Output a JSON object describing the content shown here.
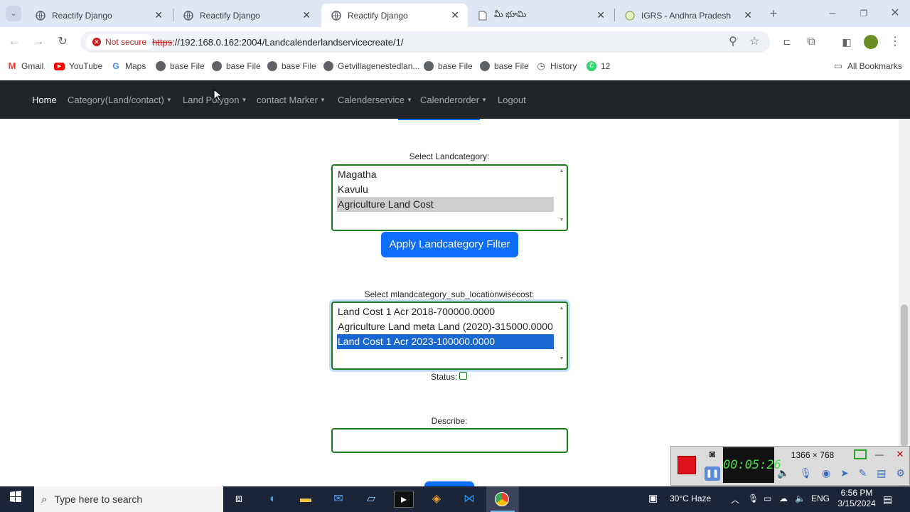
{
  "browser": {
    "tabs": [
      {
        "title": "Reactify Django",
        "active": false
      },
      {
        "title": "Reactify Django",
        "active": false
      },
      {
        "title": "Reactify Django",
        "active": true
      },
      {
        "title": "మీ భూమి",
        "active": false
      },
      {
        "title": "IGRS - Andhra Pradesh",
        "active": false
      }
    ],
    "security_label": "Not secure",
    "url_scheme": "https",
    "url_rest": "://192.168.0.162:2004/Landcalenderlandservicecreate/1/",
    "bookmarks": [
      "Gmail",
      "YouTube",
      "Maps",
      "base File",
      "base File",
      "base File",
      "Getvillagenestedlan...",
      "base File",
      "base File",
      "History",
      "12"
    ],
    "all_bookmarks": "All Bookmarks"
  },
  "navbar": {
    "items": [
      {
        "label": "Home",
        "dropdown": false
      },
      {
        "label": "Category(Land/contact)",
        "dropdown": true
      },
      {
        "label": "Land Polygon",
        "dropdown": true
      },
      {
        "label": "contact Marker",
        "dropdown": true
      },
      {
        "label": "Calenderservice",
        "dropdown": true
      },
      {
        "label": "Calenderorder",
        "dropdown": true
      },
      {
        "label": "Logout",
        "dropdown": false
      }
    ]
  },
  "form": {
    "landcategory_label": "Select Landcategory:",
    "landcategory_options": [
      "Magatha",
      "Kavulu",
      "Agriculture Land Cost"
    ],
    "landcategory_selected": "Agriculture Land Cost",
    "apply_filter_label": "Apply Landcategory Filter",
    "subcategory_label": "Select mlandcategory_sub_locationwisecost:",
    "subcategory_options": [
      "Land Cost 1 Acr 2018-700000.0000",
      "Agriculture Land meta Land (2020)-315000.0000",
      "Land Cost 1 Acr 2023-100000.0000"
    ],
    "subcategory_selected": "Land Cost 1 Acr 2023-100000.0000",
    "status_label": "Status:",
    "status_checked": false,
    "describe_label": "Describe:",
    "describe_value": ""
  },
  "recorder": {
    "timer": "00:05:26",
    "resolution": "1366 × 768"
  },
  "taskbar": {
    "search_placeholder": "Type here to search",
    "weather": "30°C  Haze",
    "language": "ENG",
    "time": "6:56 PM",
    "date": "3/15/2024"
  },
  "colors": {
    "navbar_bg": "#212529",
    "button_primary": "#0d6efd",
    "field_border": "#1a7f1a",
    "selected_option": "#1967d2"
  }
}
